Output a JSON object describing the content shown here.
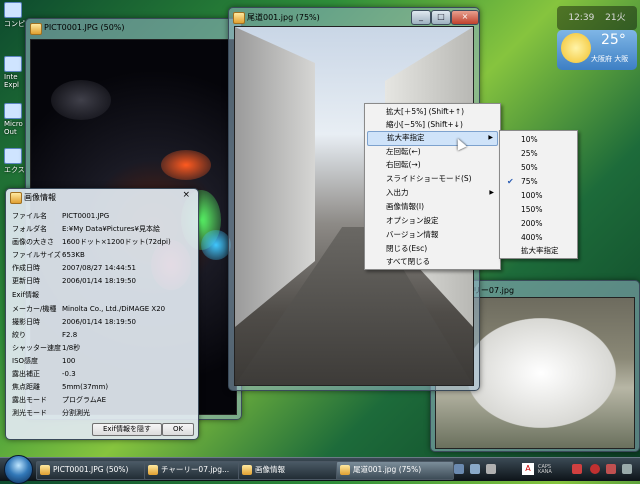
{
  "desktop": {
    "icons": [
      {
        "label": "コンピ"
      },
      {
        "label": "Inte Expl"
      },
      {
        "label": "Micro Out"
      },
      {
        "label": "エクス"
      }
    ]
  },
  "clock": {
    "time": "12:39",
    "date": "21火"
  },
  "weather": {
    "temp": "25°",
    "location": "大阪府 大阪"
  },
  "win_left": {
    "title": "PICT0001.JPG (50%)"
  },
  "win_main": {
    "title": "尾道001.jpg (75%)"
  },
  "win_cat": {
    "title": "チャーリー07.jpg"
  },
  "info": {
    "title": "画像情報",
    "rows": [
      {
        "k": "ファイル名",
        "v": "PICT0001.JPG"
      },
      {
        "k": "フォルダ名",
        "v": "E:¥My Data¥Pictures¥見本絵"
      },
      {
        "k": "画像の大きさ",
        "v": "1600ドット×1200ドット(72dpi)"
      },
      {
        "k": "ファイルサイズ",
        "v": "653KB"
      },
      {
        "k": "作成日時",
        "v": "2007/08/27 14:44:51"
      },
      {
        "k": "更新日時",
        "v": "2006/01/14 18:19:50"
      }
    ],
    "exif_header": "Exif情報",
    "exif": [
      {
        "k": "メーカー/機種",
        "v": "Minolta Co., Ltd./DiMAGE X20"
      },
      {
        "k": "撮影日時",
        "v": "2006/01/14 18:19:50"
      },
      {
        "k": "絞り",
        "v": "F2.8"
      },
      {
        "k": "シャッター速度",
        "v": "1/8秒"
      },
      {
        "k": "ISO感度",
        "v": "100"
      },
      {
        "k": "露出補正",
        "v": "-0.3"
      },
      {
        "k": "焦点距離",
        "v": "5mm(37mm)"
      },
      {
        "k": "露出モード",
        "v": "プログラムAE"
      },
      {
        "k": "測光モード",
        "v": "分割測光"
      }
    ],
    "btn_hide": "Exif情報を隠す",
    "btn_ok": "OK"
  },
  "context_menu": {
    "items": [
      {
        "label": "拡大[＋5%] (Shift+↑)"
      },
      {
        "label": "縮小[−5%] (Shift+↓)"
      },
      {
        "label": "拡大率指定",
        "submenu": true
      },
      {
        "label": "左回転(←)"
      },
      {
        "label": "右回転(→)"
      },
      {
        "label": "スライドショーモード(S)"
      },
      {
        "label": "入出力",
        "submenu": true
      },
      {
        "label": "画像情報(I)"
      },
      {
        "label": "オプション設定"
      },
      {
        "label": "バージョン情報"
      },
      {
        "label": "閉じる(Esc)"
      },
      {
        "label": "すべて閉じる"
      }
    ]
  },
  "zoom_menu": {
    "items": [
      "10%",
      "25%",
      "50%",
      "75%",
      "100%",
      "150%",
      "200%",
      "400%",
      "拡大率指定"
    ],
    "checked": "75%"
  },
  "taskbar": {
    "buttons": [
      {
        "label": "PICT0001.JPG (50%)"
      },
      {
        "label": "チャーリー07.jpg..."
      },
      {
        "label": "画像情報"
      },
      {
        "label": "尾道001.jpg (75%)"
      }
    ],
    "tray": "CAPS KANA"
  }
}
